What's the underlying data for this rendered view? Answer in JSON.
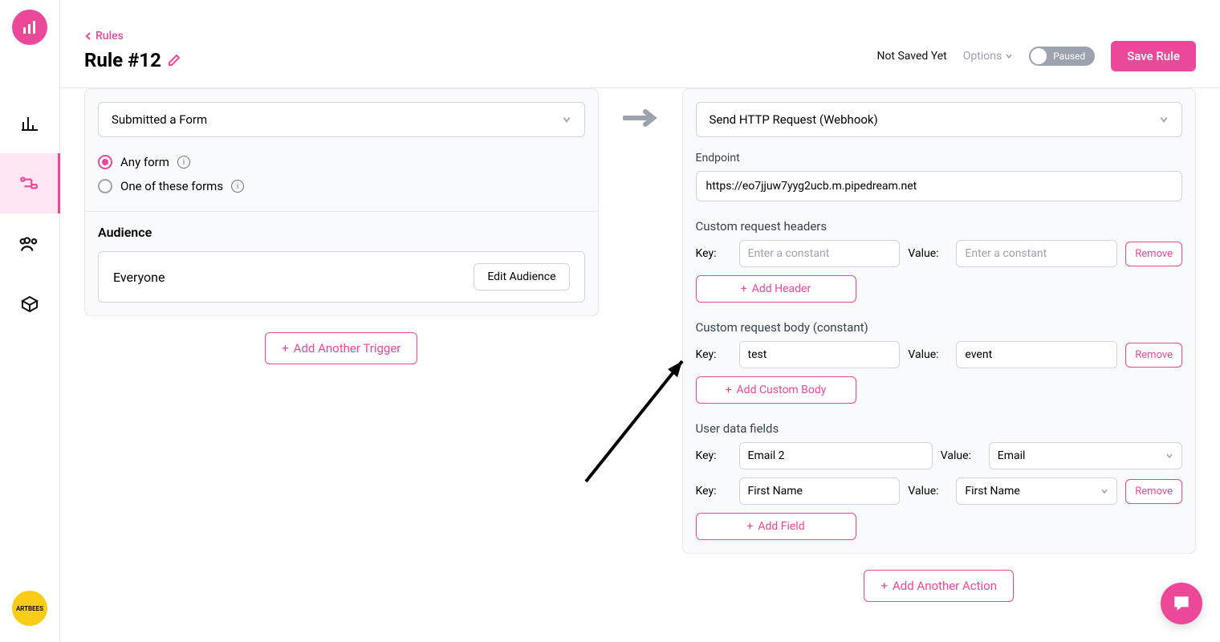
{
  "breadcrumb": {
    "label": "Rules"
  },
  "page": {
    "title": "Rule #12"
  },
  "header": {
    "status": "Not Saved Yet",
    "options": "Options",
    "toggle_label": "Paused",
    "save": "Save Rule"
  },
  "trigger": {
    "select": "Submitted a Form",
    "radio_any": "Any form",
    "radio_one": "One of these forms",
    "audience_title": "Audience",
    "audience_value": "Everyone",
    "edit_audience": "Edit Audience",
    "add_trigger": "Add Another Trigger"
  },
  "action": {
    "select": "Send HTTP Request (Webhook)",
    "endpoint_label": "Endpoint",
    "endpoint_value": "https://eo7jjuw7yyg2ucb.m.pipedream.net",
    "headers_title": "Custom request headers",
    "key_label": "Key:",
    "value_label": "Value:",
    "placeholder_constant": "Enter a constant",
    "remove": "Remove",
    "add_header": "Add Header",
    "body_title": "Custom request body (constant)",
    "body_key": "test",
    "body_value": "event",
    "add_body": "Add Custom Body",
    "fields_title": "User data fields",
    "field1_key": "Email 2",
    "field1_value": "Email",
    "field2_key": "First Name",
    "field2_value": "First Name",
    "add_field": "Add Field",
    "add_action": "Add Another Action"
  },
  "avatar": {
    "label": "ARTBEES"
  }
}
